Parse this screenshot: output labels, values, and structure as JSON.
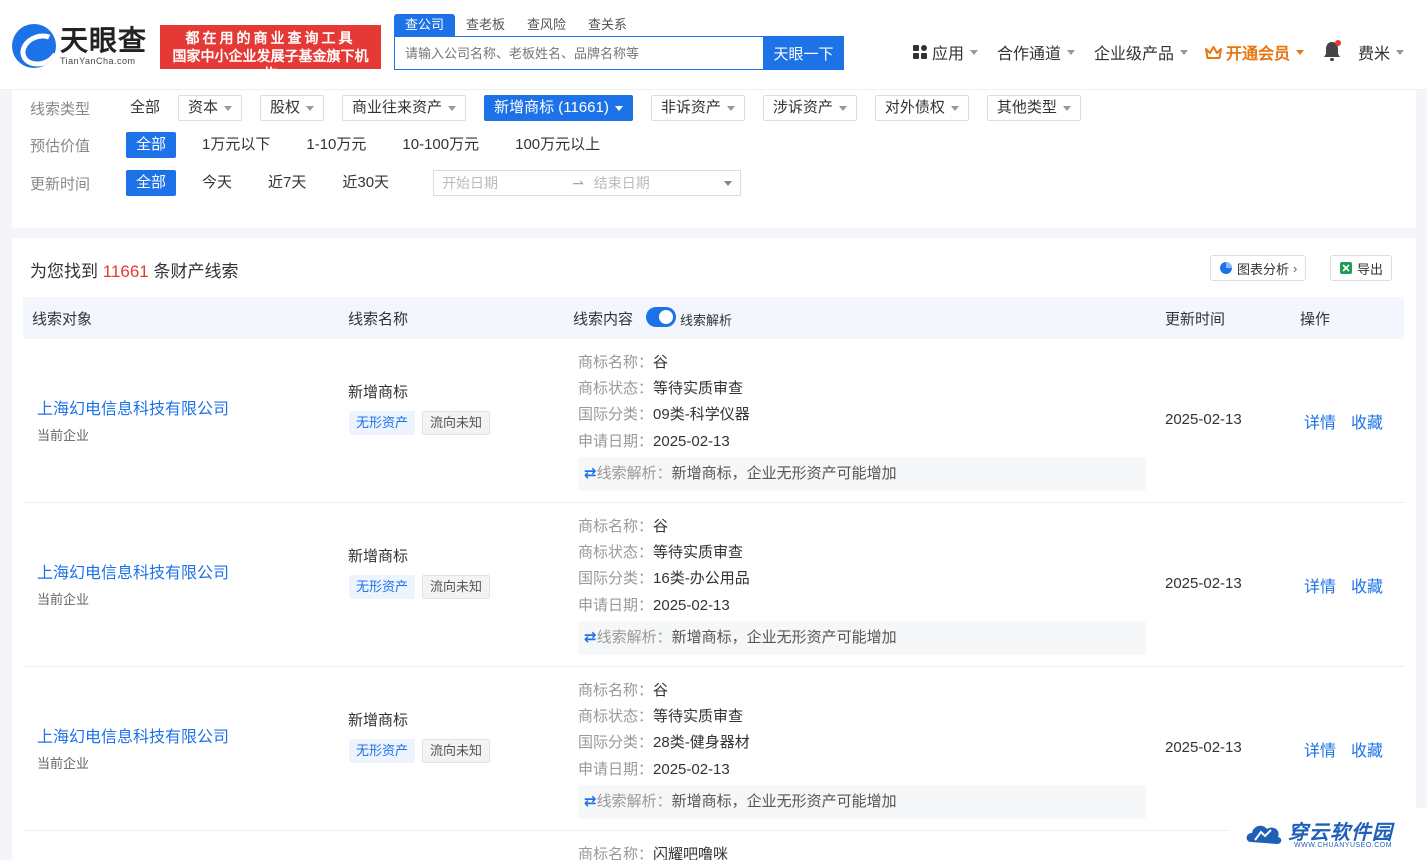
{
  "header": {
    "logo_cn": "天眼查",
    "logo_en": "TianYanCha.com",
    "slogan_line1": "都在用的商业查询工具",
    "slogan_line2": "国家中小企业发展子基金旗下机构",
    "search_tabs": [
      "查公司",
      "查老板",
      "查风险",
      "查关系"
    ],
    "search_placeholder": "请输入公司名称、老板姓名、品牌名称等",
    "search_button": "天眼一下",
    "nav": {
      "apps": "应用",
      "cooperation": "合作通道",
      "enterprise": "企业级产品",
      "vip": "开通会员",
      "user": "费米"
    }
  },
  "filters": {
    "type_label": "线索类型",
    "type_all": "全部",
    "type_options": [
      "资本",
      "股权",
      "商业往来资产",
      "新增商标 (11661)",
      "非诉资产",
      "涉诉资产",
      "对外债权",
      "其他类型"
    ],
    "value_label": "预估价值",
    "value_options": [
      "全部",
      "1万元以下",
      "1-10万元",
      "10-100万元",
      "100万元以上"
    ],
    "time_label": "更新时间",
    "time_options": [
      "全部",
      "今天",
      "近7天",
      "近30天"
    ],
    "start_date": "开始日期",
    "end_date": "结束日期"
  },
  "results": {
    "prefix": "为您找到",
    "count": "11661",
    "suffix": "条财产线索",
    "chart_button": "图表分析",
    "export_button": "导出",
    "columns": {
      "object": "线索对象",
      "name": "线索名称",
      "content": "线索内容",
      "analysis_toggle": "线索解析",
      "updated": "更新时间",
      "action": "操作"
    },
    "labels": {
      "tm_name": "商标名称：",
      "tm_status": "商标状态：",
      "intl_class": "国际分类：",
      "apply_date": "申请日期：",
      "analysis": "线索解析："
    },
    "rows": [
      {
        "company": "上海幻电信息科技有限公司",
        "sub": "当前企业",
        "clue": "新增商标",
        "tag1": "无形资产",
        "tag2": "流向未知",
        "tm_name": "谷",
        "tm_status": "等待实质审查",
        "intl_class": "09类-科学仪器",
        "apply_date": "2025-02-13",
        "analysis": "新增商标，企业无形资产可能增加",
        "updated": "2025-02-13",
        "detail": "详情",
        "fav": "收藏"
      },
      {
        "company": "上海幻电信息科技有限公司",
        "sub": "当前企业",
        "clue": "新增商标",
        "tag1": "无形资产",
        "tag2": "流向未知",
        "tm_name": "谷",
        "tm_status": "等待实质审查",
        "intl_class": "16类-办公用品",
        "apply_date": "2025-02-13",
        "analysis": "新增商标，企业无形资产可能增加",
        "updated": "2025-02-13",
        "detail": "详情",
        "fav": "收藏"
      },
      {
        "company": "上海幻电信息科技有限公司",
        "sub": "当前企业",
        "clue": "新增商标",
        "tag1": "无形资产",
        "tag2": "流向未知",
        "tm_name": "谷",
        "tm_status": "等待实质审查",
        "intl_class": "28类-健身器材",
        "apply_date": "2025-02-13",
        "analysis": "新增商标，企业无形资产可能增加",
        "updated": "2025-02-13",
        "detail": "详情",
        "fav": "收藏"
      }
    ],
    "partial_row_tm_name": "闪耀吧噜咪"
  },
  "watermark": {
    "cn": "穿云软件园",
    "en": "WWW.CHUANYUSEO.COM"
  },
  "colors": {
    "primary": "#1e72e8",
    "accent_red": "#e53935",
    "vip": "#e87511"
  }
}
